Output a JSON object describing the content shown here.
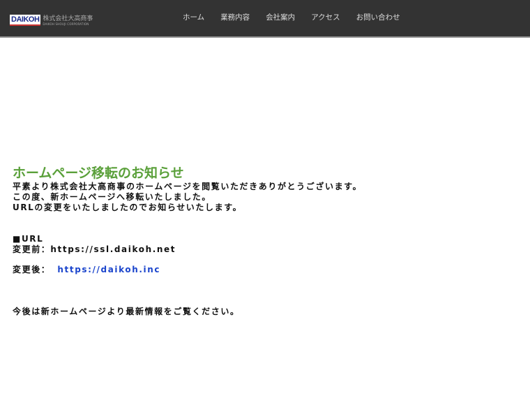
{
  "header": {
    "logo": {
      "mark": "DAIKOH",
      "jp": "株式会社大高商事",
      "en": "DAIKOH SHOUJI CORPORATION"
    },
    "nav": [
      "ホーム",
      "業務内容",
      "会社案内",
      "アクセス",
      "お問い合わせ"
    ]
  },
  "notice": {
    "title": "ホームページ移転のお知らせ",
    "lines": [
      "平素より株式会社大高商事のホームページを閲覧いただきありがとうございます。",
      "この度、新ホームページへ移転いたしました。",
      "URLの変更をいたしましたのでお知らせいたします。"
    ],
    "url_heading": "■URL",
    "before": "変更前：https://ssl.daikoh.net",
    "after_label": "変更後：",
    "after_link": "https://daikoh.inc",
    "closing": "今後は新ホームページより最新情報をご覧ください。"
  },
  "colors": {
    "header_bg": "#333333",
    "title": "#5aa03a",
    "link": "#1a44cc"
  }
}
